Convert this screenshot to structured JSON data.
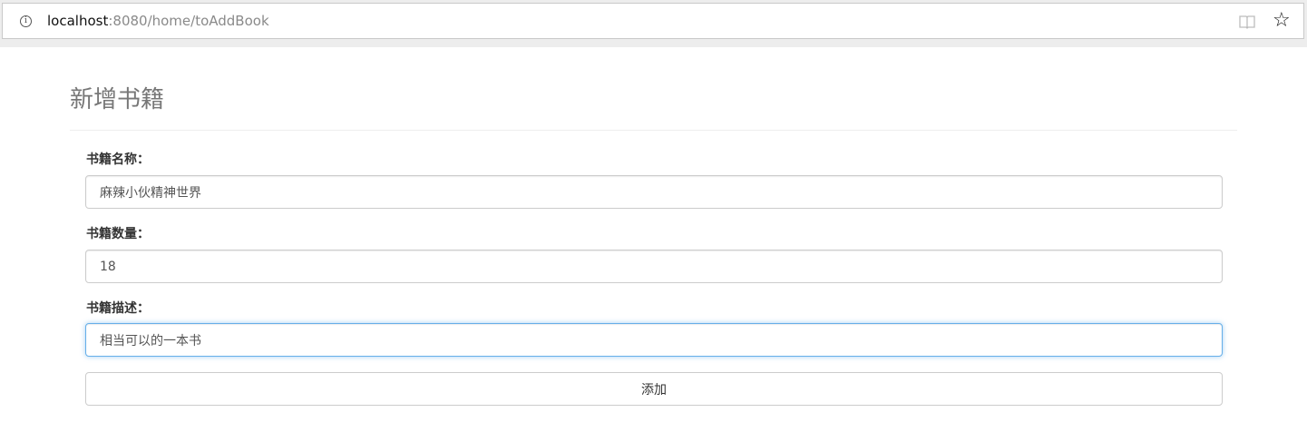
{
  "browser": {
    "url_host": "localhost",
    "url_rest": ":8080/home/toAddBook",
    "info_glyph": "i",
    "info_icon": "info-icon",
    "reader_icon": "reader-view-icon",
    "star_glyph": "☆",
    "star_icon": "bookmark-star-icon"
  },
  "page": {
    "title": "新增书籍"
  },
  "form": {
    "name": {
      "label": "书籍名称：",
      "value": "麻辣小伙精神世界"
    },
    "count": {
      "label": "书籍数量：",
      "value": "18"
    },
    "description": {
      "label": "书籍描述：",
      "value": "相当可以的一本书",
      "focused": true
    },
    "submit_label": "添加"
  },
  "colors": {
    "title": "#777777",
    "label": "#333333",
    "input_border": "#cccccc",
    "focus_border": "#66afe9"
  }
}
